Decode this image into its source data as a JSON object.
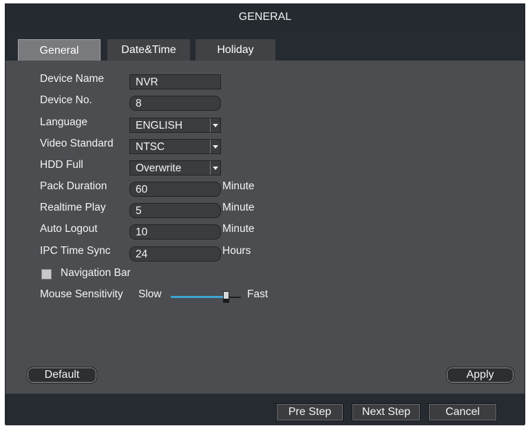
{
  "window": {
    "title": "GENERAL"
  },
  "tabs": [
    {
      "label": "General",
      "active": true
    },
    {
      "label": "Date&Time",
      "active": false
    },
    {
      "label": "Holiday",
      "active": false
    }
  ],
  "form": {
    "device_name": {
      "label": "Device Name",
      "value": "NVR"
    },
    "device_no": {
      "label": "Device No.",
      "value": "8"
    },
    "language": {
      "label": "Language",
      "value": "ENGLISH"
    },
    "video_standard": {
      "label": "Video Standard",
      "value": "NTSC"
    },
    "hdd_full": {
      "label": "HDD Full",
      "value": "Overwrite"
    },
    "pack_duration": {
      "label": "Pack Duration",
      "value": "60",
      "unit": "Minute"
    },
    "realtime_play": {
      "label": "Realtime Play",
      "value": "5",
      "unit": "Minute"
    },
    "auto_logout": {
      "label": "Auto Logout",
      "value": "10",
      "unit": "Minute"
    },
    "ipc_time_sync": {
      "label": "IPC Time Sync",
      "value": "24",
      "unit": "Hours"
    },
    "navigation_bar": {
      "label": "Navigation Bar",
      "checked": false
    },
    "mouse_sensitivity": {
      "label": "Mouse Sensitivity",
      "min_label": "Slow",
      "max_label": "Fast",
      "level": 0.82
    }
  },
  "actions": {
    "default_label": "Default",
    "apply_label": "Apply"
  },
  "footer": {
    "pre_step_label": "Pre Step",
    "next_step_label": "Next Step",
    "cancel_label": "Cancel"
  },
  "colors": {
    "title_bg": "#252a30",
    "panel_bg": "#4b4d51",
    "slider_accent": "#3ea6d4"
  }
}
